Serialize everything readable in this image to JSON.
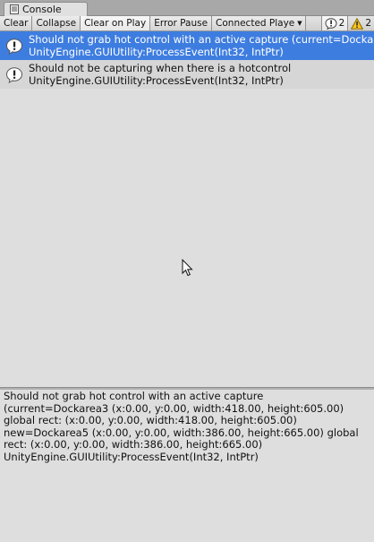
{
  "window": {
    "tab_title": "Console"
  },
  "toolbar": {
    "clear_label": "Clear",
    "collapse_label": "Collapse",
    "clear_on_play_label": "Clear on Play",
    "error_pause_label": "Error Pause",
    "connected_player_label": "Connected Playe",
    "info_count": "2",
    "warning_count": "2"
  },
  "log": {
    "entries": [
      {
        "line1": "Should not grab hot control with an active capture (current=Dockarea",
        "line2": "UnityEngine.GUIUtility:ProcessEvent(Int32, IntPtr)",
        "selected": true
      },
      {
        "line1": "Should not be capturing when there is a hotcontrol",
        "line2": "UnityEngine.GUIUtility:ProcessEvent(Int32, IntPtr)",
        "selected": false
      }
    ]
  },
  "detail": {
    "text": "Should not grab hot control with an active capture (current=Dockarea3 (x:0.00, y:0.00, width:418.00, height:605.00) global rect: (x:0.00, y:0.00, width:418.00, height:605.00) new=Dockarea5 (x:0.00, y:0.00, width:386.00, height:665.00) global rect: (x:0.00, y:0.00, width:386.00, height:665.00)\nUnityEngine.GUIUtility:ProcessEvent(Int32, IntPtr)"
  },
  "colors": {
    "selection": "#3e7de0",
    "list_background": "#dedede",
    "toolbar_background": "#d4d4d4"
  },
  "icons": {
    "tab": "console-document-icon",
    "log_entry": "info-bubble-icon",
    "info_counter": "info-bubble-icon",
    "warning_counter": "warning-triangle-icon",
    "cursor": "mouse-pointer-icon"
  }
}
